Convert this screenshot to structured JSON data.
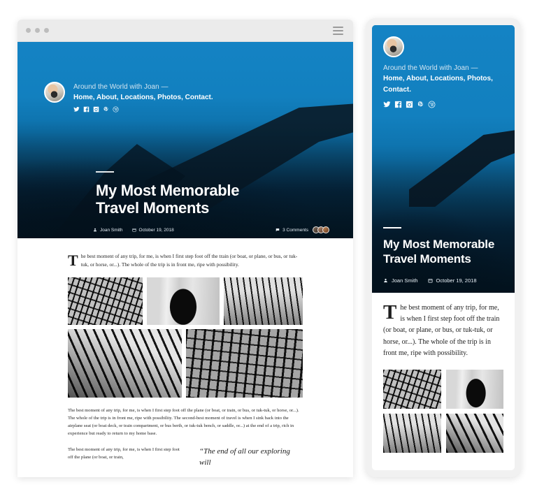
{
  "browser": {
    "dots_count": 3,
    "menu_icon": "hamburger-icon"
  },
  "site": {
    "tagline": "Around the World with Joan —",
    "nav_text": "Home, About, Locations, Photos, Contact.",
    "nav_items": [
      "Home",
      "About",
      "Locations",
      "Photos",
      "Contact"
    ],
    "avatar": "author-avatar",
    "socials": [
      {
        "name": "twitter-icon",
        "label": "Twitter"
      },
      {
        "name": "facebook-icon",
        "label": "Facebook"
      },
      {
        "name": "instagram-icon",
        "label": "Instagram"
      },
      {
        "name": "pinterest-icon",
        "label": "Pinterest"
      },
      {
        "name": "wordpress-icon",
        "label": "WordPress"
      }
    ]
  },
  "post": {
    "title_line1": "My Most Memorable",
    "title_line2": "Travel Moments",
    "author": "Joan Smith",
    "date": "October 19, 2018",
    "comments": "3 Comments",
    "comment_avatar_count": 3,
    "lead": "The best moment of any trip, for me, is when I first step foot off the train (or boat, or plane, or bus, or tuk-tuk, or horse, or...). The whole of the trip is in front me, ripe with possibility.",
    "paragraph_2": "The best moment of any trip, for me, is when I first step foot off the plane (or boat, or train, or bus, or tuk-tuk, or horse, or...). The whole of the trip is in front me, ripe with possibility. The second-best moment of travel is when I sink back into the airplane seat (or boat deck, or train compartment, or bus berth, or tuk-tuk bench, or saddle, or...) at the end of a trip, rich in experience but ready to return to my home base.",
    "paragraph_3": "The best moment of any trip, for me, is when I first step foot off the plane (or boat, or train,",
    "pullquote": "“The end of all our exploring will"
  },
  "mobile": {
    "lead": "The best moment of any trip, for me, is when I first step foot off the train (or boat, or plane, or bus, or tuk-tuk, or horse, or...). The whole of the trip is in front me, ripe with possibility."
  },
  "gallery": {
    "desktop_images": [
      "station-roof-girders",
      "traveler-with-backpack-motion-blur",
      "platform-canopy-long-view",
      "glass-roof-diagonal",
      "grand-hall-arched-windows"
    ],
    "mobile_images": [
      "station-roof-girders",
      "traveler-with-backpack-motion-blur",
      "platform-canopy-long-view",
      "glass-roof-diagonal"
    ]
  },
  "colors": {
    "hero_blue": "#1280bf",
    "hero_dark": "#04202f",
    "chrome_grey": "#ebebeb",
    "phone_body": "#f1f1f1"
  }
}
